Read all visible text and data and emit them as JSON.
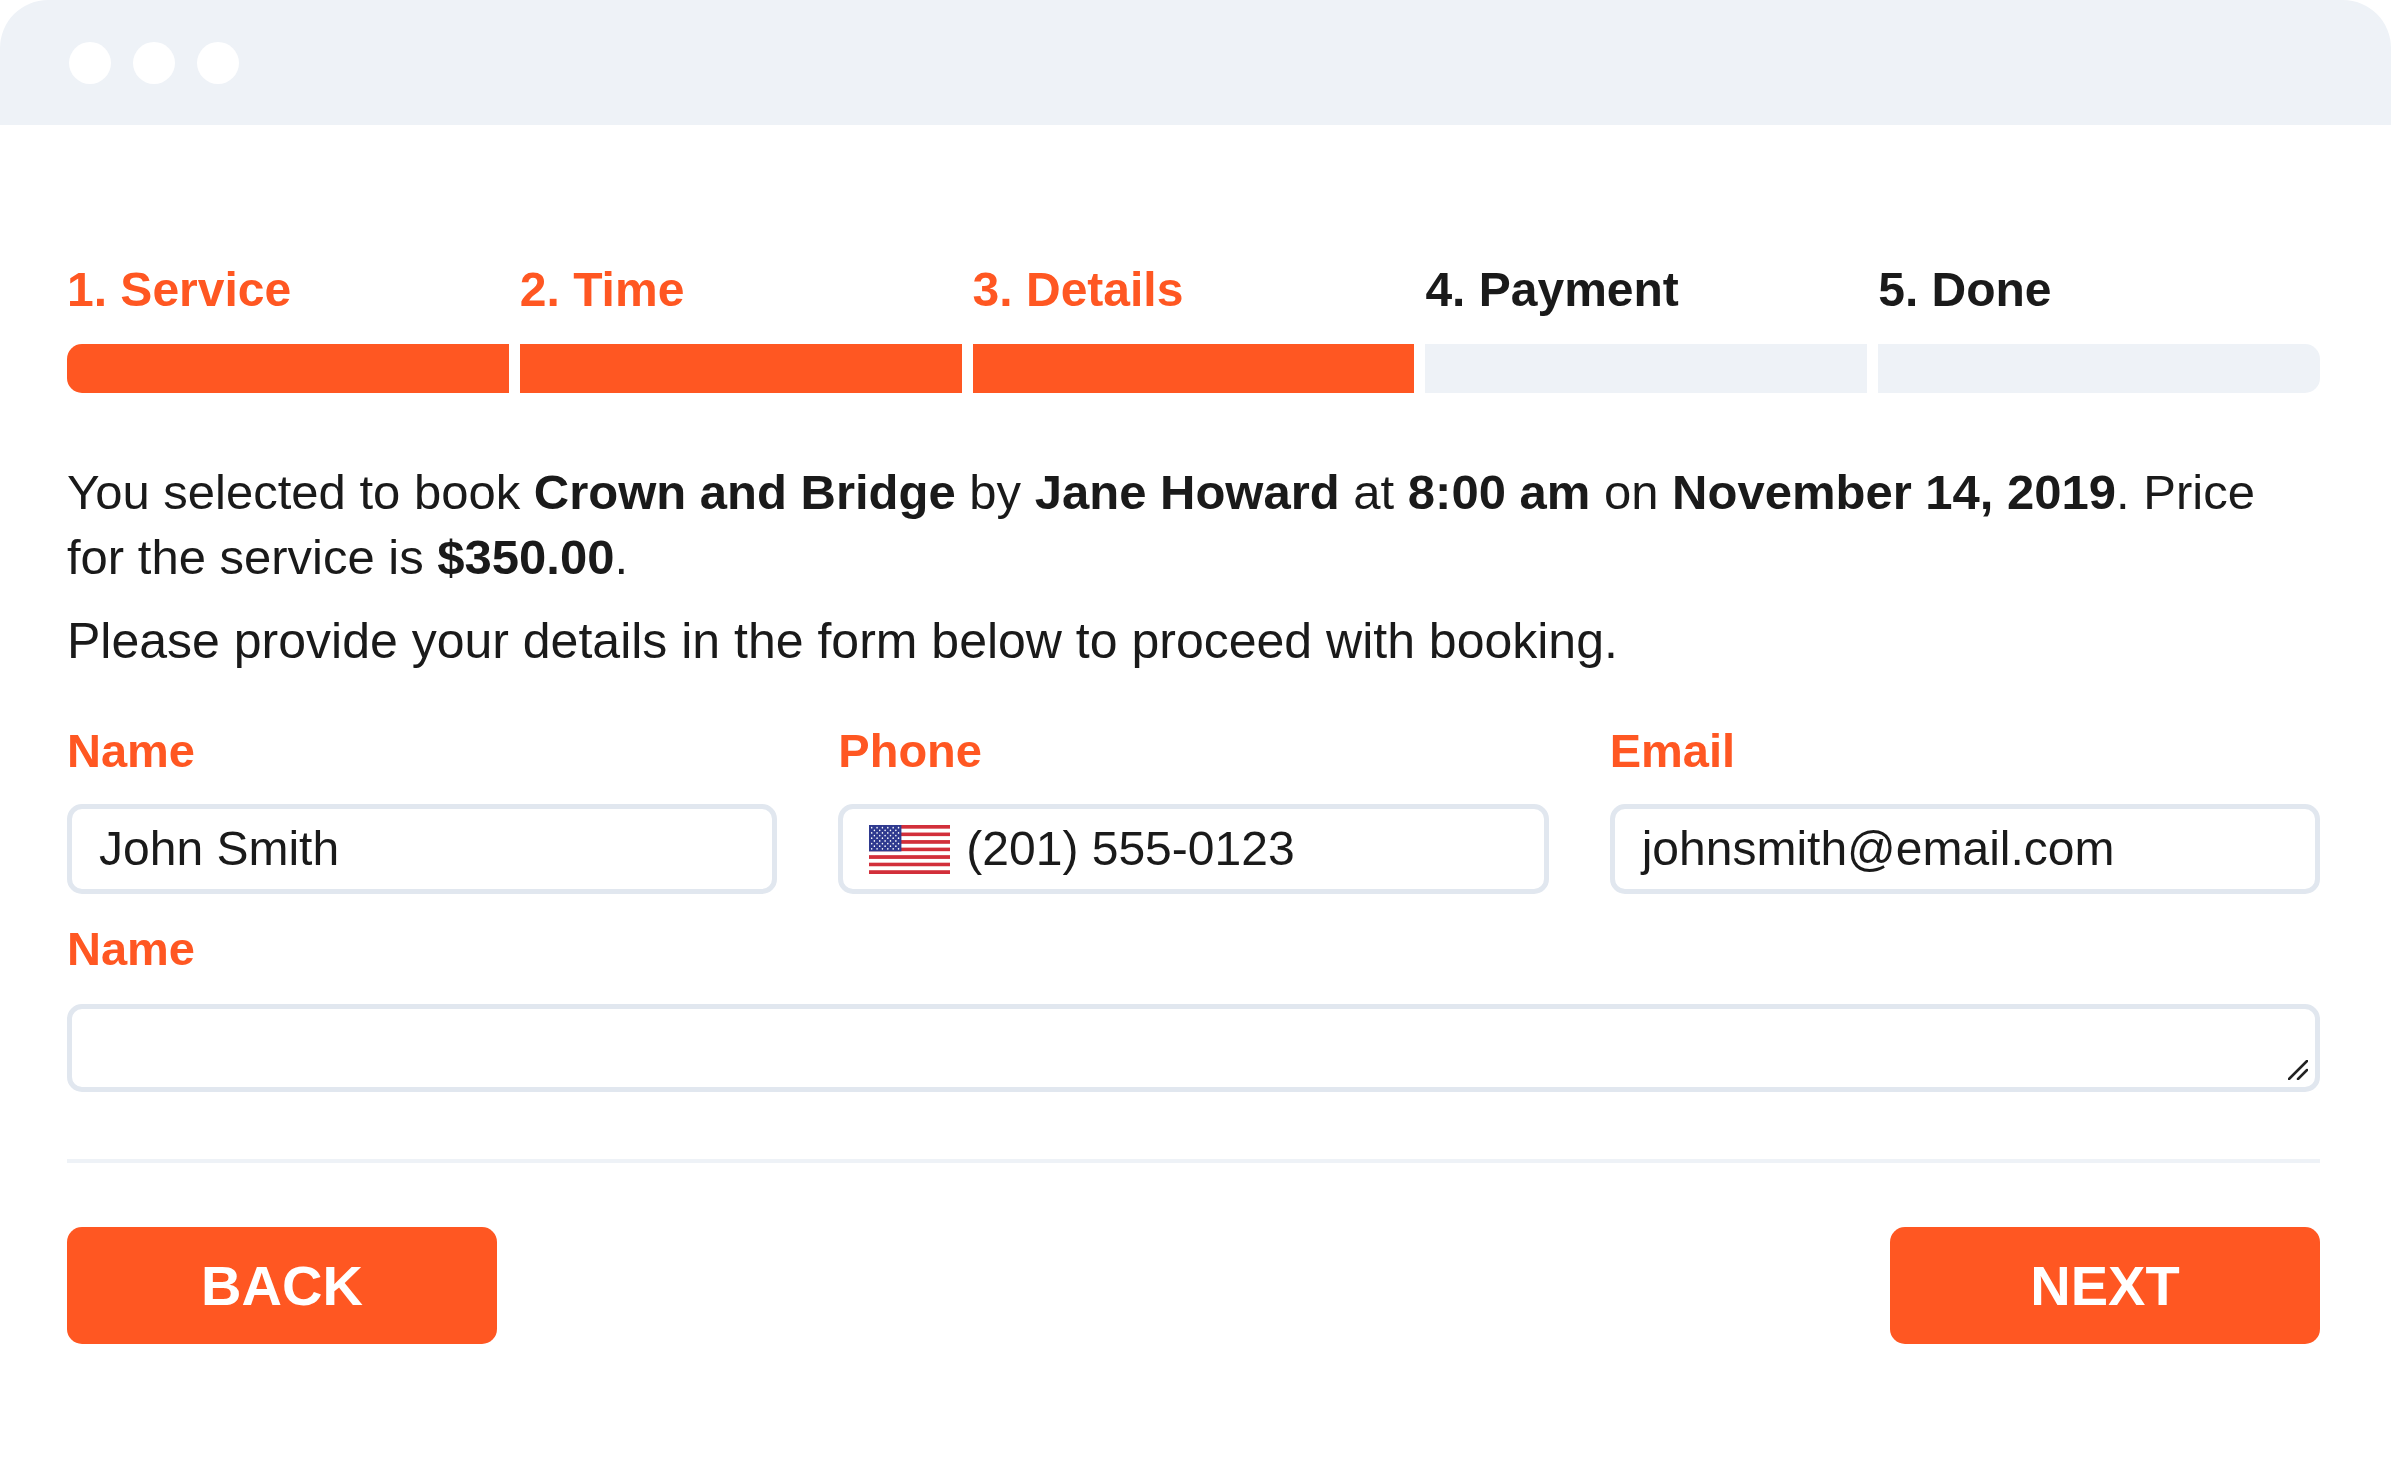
{
  "steps": [
    {
      "label": "1. Service",
      "completed": true
    },
    {
      "label": "2. Time",
      "completed": true
    },
    {
      "label": "3. Details",
      "completed": true
    },
    {
      "label": "4. Payment",
      "completed": false
    },
    {
      "label": "5. Done",
      "completed": false
    }
  ],
  "summary": "You selected to book **Crown and Bridge** by **Jane Howard** at **8:00 am** on **November 14, 2019**. Price for the service is **$350.00**.",
  "instruction": "Please provide your details in the form below to proceed with booking.",
  "fields": [
    {
      "label": "Name",
      "kind": "text",
      "value": "John Smith"
    },
    {
      "label": "Phone",
      "kind": "phone",
      "value": "(201) 555-0123"
    },
    {
      "label": "Email",
      "kind": "text",
      "value": "johnsmith@email.com"
    }
  ],
  "notes": {
    "label": "Name"
  },
  "buttons": [
    "BACK",
    "NEXT"
  ]
}
